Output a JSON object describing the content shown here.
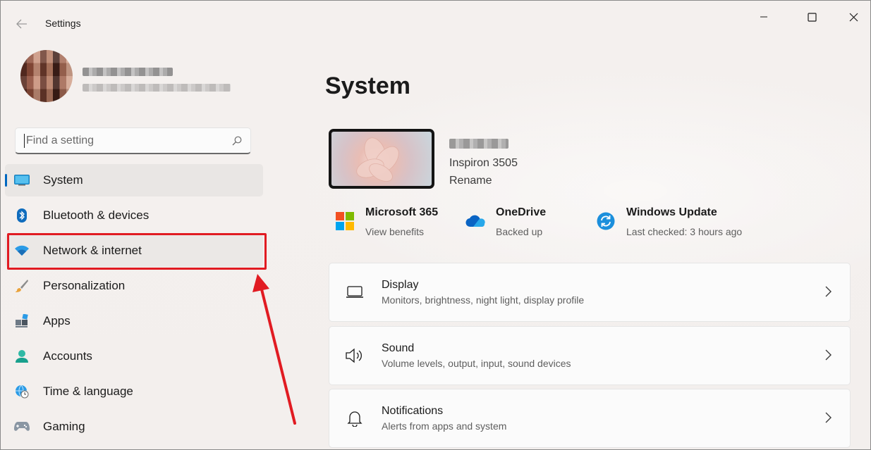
{
  "window": {
    "title": "Settings"
  },
  "search": {
    "placeholder": "Find a setting"
  },
  "sidebar": {
    "items": [
      {
        "label": "System",
        "icon": "system-icon"
      },
      {
        "label": "Bluetooth & devices",
        "icon": "bluetooth-icon"
      },
      {
        "label": "Network & internet",
        "icon": "wifi-icon"
      },
      {
        "label": "Personalization",
        "icon": "brush-icon"
      },
      {
        "label": "Apps",
        "icon": "apps-icon"
      },
      {
        "label": "Accounts",
        "icon": "person-icon"
      },
      {
        "label": "Time & language",
        "icon": "globe-clock-icon"
      },
      {
        "label": "Gaming",
        "icon": "gamepad-icon"
      }
    ]
  },
  "main": {
    "title": "System",
    "device": {
      "model": "Inspiron 3505",
      "rename_label": "Rename"
    },
    "quick": [
      {
        "title": "Microsoft 365",
        "subtitle": "View benefits",
        "icon": "microsoft-logo-icon"
      },
      {
        "title": "OneDrive",
        "subtitle": "Backed up",
        "icon": "onedrive-cloud-icon"
      },
      {
        "title": "Windows Update",
        "subtitle": "Last checked: 3 hours ago",
        "icon": "windows-update-icon"
      }
    ],
    "cards": [
      {
        "title": "Display",
        "subtitle": "Monitors, brightness, night light, display profile",
        "icon": "laptop-icon"
      },
      {
        "title": "Sound",
        "subtitle": "Volume levels, output, input, sound devices",
        "icon": "speaker-icon"
      },
      {
        "title": "Notifications",
        "subtitle": "Alerts from apps and system",
        "icon": "bell-icon"
      }
    ]
  },
  "colors": {
    "accent": "#0067c0",
    "annotation": "#e11b22"
  }
}
